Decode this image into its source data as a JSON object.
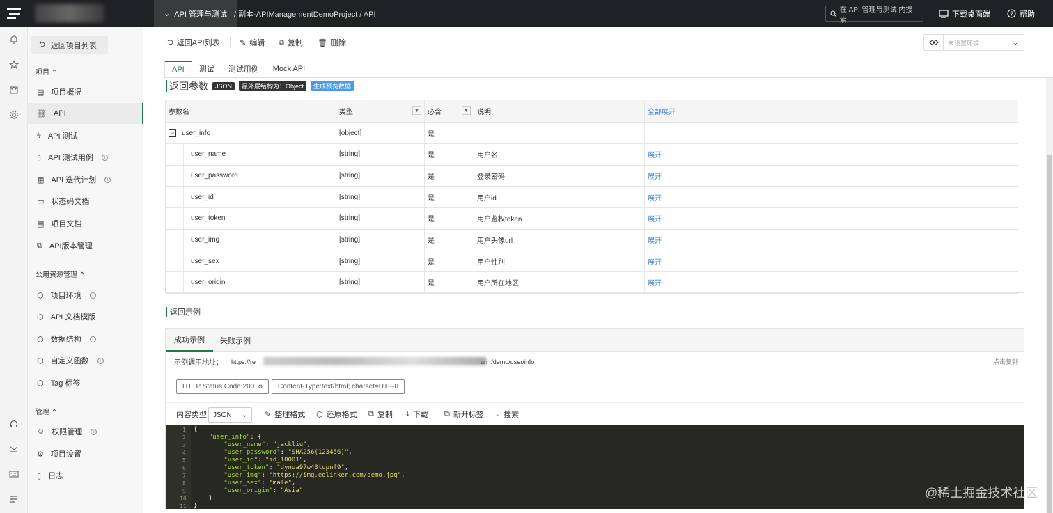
{
  "topbar": {
    "project_dropdown": "API 管理与测试",
    "breadcrumb": "/ 副本-APIManagementDemoProject / API",
    "search_placeholder": "在 API 管理与测试 内搜索",
    "download": "下载桌面端",
    "help": "帮助"
  },
  "sidebar": {
    "back": "返回项目列表",
    "sections": {
      "project": "项目",
      "public": "公用资源管理",
      "manage": "管理"
    },
    "project_items": [
      {
        "label": "项目概况"
      },
      {
        "label": "API"
      },
      {
        "label": "API 测试"
      },
      {
        "label": "API 测试用例"
      },
      {
        "label": "API 迭代计划"
      },
      {
        "label": "状态码文档"
      },
      {
        "label": "项目文档"
      },
      {
        "label": "API版本管理"
      }
    ],
    "public_items": [
      {
        "label": "项目环境"
      },
      {
        "label": "API 文档模版"
      },
      {
        "label": "数据结构"
      },
      {
        "label": "自定义函数"
      },
      {
        "label": "Tag 标签"
      }
    ],
    "manage_items": [
      {
        "label": "权限管理"
      },
      {
        "label": "项目设置"
      },
      {
        "label": "日志"
      }
    ]
  },
  "toolbar": {
    "back": "返回API列表",
    "edit": "编辑",
    "copy": "复制",
    "delete": "删除",
    "env_placeholder": "未设置环境"
  },
  "tabs": [
    "API",
    "测试",
    "测试用例",
    "Mock API"
  ],
  "response_params": {
    "title": "返回参数",
    "badge_json": "JSON",
    "badge_struct": "最外层结构为：Object",
    "badge_preview": "生成预览数据",
    "headers": {
      "name": "参数名",
      "type": "类型",
      "required": "必含",
      "desc": "说明",
      "expand_all": "全部展开"
    },
    "rows": [
      {
        "name": "user_info",
        "type": "[object]",
        "required": "是",
        "desc": "",
        "action": ""
      },
      {
        "name": "user_name",
        "type": "[string]",
        "required": "是",
        "desc": "用户名",
        "action": "展开"
      },
      {
        "name": "user_password",
        "type": "[string]",
        "required": "是",
        "desc": "登录密码",
        "action": "展开"
      },
      {
        "name": "user_id",
        "type": "[string]",
        "required": "是",
        "desc": "用户id",
        "action": "展开"
      },
      {
        "name": "user_token",
        "type": "[string]",
        "required": "是",
        "desc": "用户鉴权token",
        "action": "展开"
      },
      {
        "name": "user_img",
        "type": "[string]",
        "required": "是",
        "desc": "用户头像url",
        "action": "展开"
      },
      {
        "name": "user_sex",
        "type": "[string]",
        "required": "是",
        "desc": "用户性别",
        "action": "展开"
      },
      {
        "name": "user_origin",
        "type": "[string]",
        "required": "是",
        "desc": "用户所在地区",
        "action": "展开"
      }
    ]
  },
  "example": {
    "title": "返回示例",
    "tab_success": "成功示例",
    "tab_fail": "失败示例",
    "url_label": "示例调用地址：",
    "url_prefix": "https://re",
    "url_suffix": "uri=/demo/user/info",
    "copy_link": "点击复制",
    "chip_status": "HTTP Status Code:200",
    "chip_content_type": "Content-Type:text/html; charset=UTF-8",
    "content_type_label": "内容类型",
    "content_type_value": "JSON",
    "tools": [
      "整理格式",
      "还原格式",
      "复制",
      "下载",
      "新开标签",
      "搜索"
    ],
    "code_lines": [
      "{",
      "    \"user_info\": {",
      "        \"user_name\": \"jackliu\",",
      "        \"user_password\": \"SHA256(123456)\",",
      "        \"user_id\": \"id_10001\",",
      "        \"user_token\": \"dynoa97w43topnf9\",",
      "        \"user_img\": \"https://img.eolinker.com/demo.jpg\",",
      "        \"user_sex\": \"male\",",
      "        \"user_origin\": \"Asia\"",
      "    }",
      "}"
    ],
    "line_numbers": [
      "1",
      "2",
      "3",
      "4",
      "5",
      "6",
      "7",
      "8",
      "9",
      "10",
      "11"
    ]
  },
  "watermark": "@稀土掘金技术社区",
  "colors": {
    "accent": "#1e7a4a",
    "link": "#2f7fd6",
    "topbar": "#202124",
    "code_bg": "#272822"
  }
}
